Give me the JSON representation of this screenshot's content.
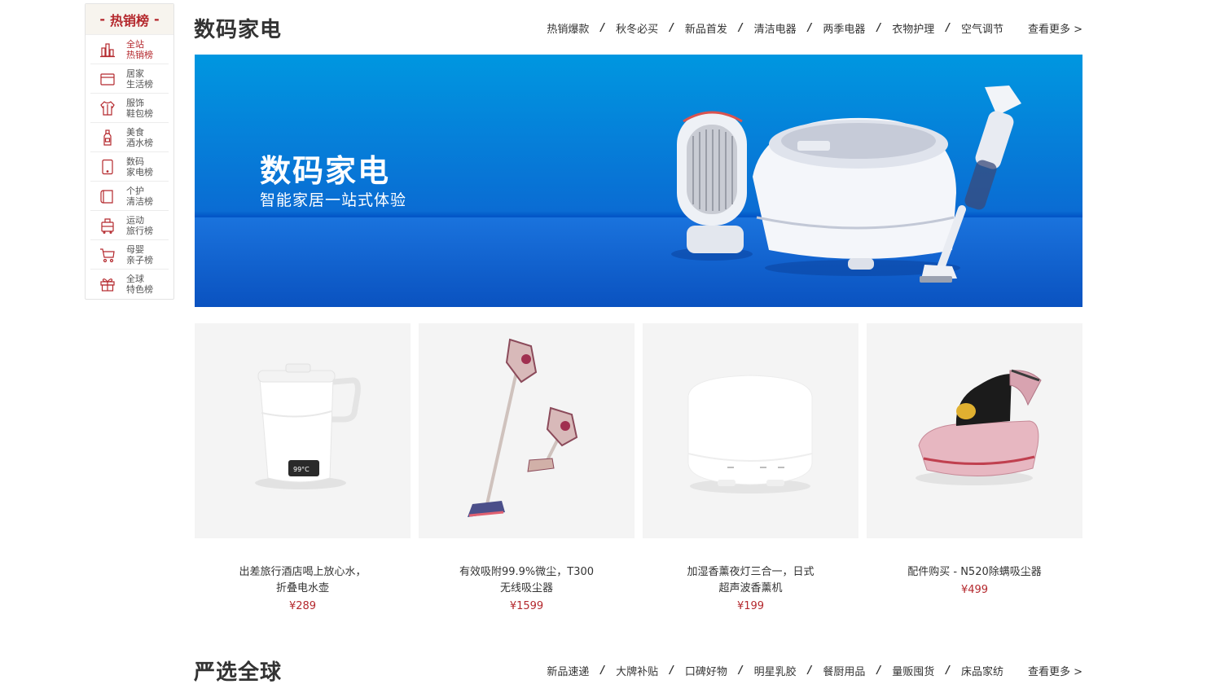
{
  "sidebar": {
    "title": "热销榜",
    "items": [
      {
        "label": "全站\n热销榜",
        "icon": "bar-chart-icon",
        "active": true
      },
      {
        "label": "居家\n生活榜",
        "icon": "home-appliance-icon",
        "active": false
      },
      {
        "label": "服饰\n鞋包榜",
        "icon": "shirt-icon",
        "active": false
      },
      {
        "label": "美食\n酒水榜",
        "icon": "bottle-icon",
        "active": false
      },
      {
        "label": "数码\n家电榜",
        "icon": "phone-icon",
        "active": false
      },
      {
        "label": "个护\n清洁榜",
        "icon": "towel-icon",
        "active": false
      },
      {
        "label": "运动\n旅行榜",
        "icon": "suitcase-icon",
        "active": false
      },
      {
        "label": "母婴\n亲子榜",
        "icon": "stroller-icon",
        "active": false
      },
      {
        "label": "全球\n特色榜",
        "icon": "gift-icon",
        "active": false
      }
    ]
  },
  "section1": {
    "title": "数码家电",
    "categories": [
      "热销爆款",
      "秋冬必买",
      "新品首发",
      "清洁电器",
      "两季电器",
      "衣物护理",
      "空气调节"
    ],
    "more": "查看更多 >",
    "banner": {
      "title": "数码家电",
      "subtitle": "智能家居一站式体验"
    },
    "products": [
      {
        "name": "出差旅行酒店喝上放心水，\n折叠电水壶",
        "price": "¥289",
        "image": "kettle"
      },
      {
        "name": "有效吸附99.9%微尘，T300\n无线吸尘器",
        "price": "¥1599",
        "image": "stick-vacuum"
      },
      {
        "name": "加湿香薰夜灯三合一，日式\n超声波香薰机",
        "price": "¥199",
        "image": "diffuser"
      },
      {
        "name": "配件购买 - N520除螨吸尘器",
        "price": "¥499",
        "image": "mite-vacuum"
      }
    ]
  },
  "section2": {
    "title": "严选全球",
    "categories": [
      "新品速递",
      "大牌补贴",
      "口碑好物",
      "明星乳胶",
      "餐厨用品",
      "量贩囤货",
      "床品家纺"
    ],
    "more": "查看更多 >"
  },
  "colors": {
    "accent": "#b4282d",
    "banner": "#0a6cd3"
  }
}
